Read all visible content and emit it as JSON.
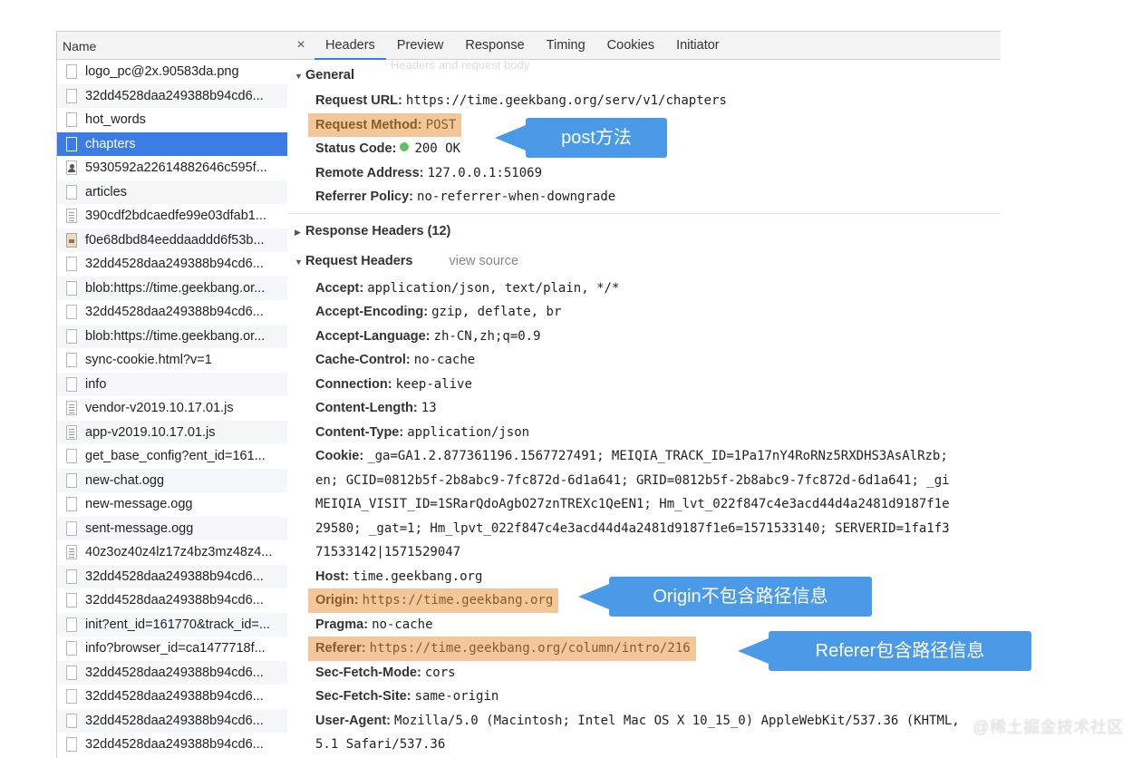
{
  "left": {
    "header": "Name",
    "items": [
      {
        "name": "logo_pc@2x.90583da.png",
        "icon": "file"
      },
      {
        "name": "32dd4528daa249388b94cd6...",
        "icon": "file"
      },
      {
        "name": "hot_words",
        "icon": "file"
      },
      {
        "name": "chapters",
        "icon": "file",
        "selected": true
      },
      {
        "name": "5930592a22614882646c595f...",
        "icon": "person"
      },
      {
        "name": "articles",
        "icon": "file"
      },
      {
        "name": "390cdf2bdcaedfe99e03dfab1...",
        "icon": "doc"
      },
      {
        "name": "f0e68dbd84eeddaaddd6f53b...",
        "icon": "img"
      },
      {
        "name": "32dd4528daa249388b94cd6...",
        "icon": "file"
      },
      {
        "name": "blob:https://time.geekbang.or...",
        "icon": "file"
      },
      {
        "name": "32dd4528daa249388b94cd6...",
        "icon": "file"
      },
      {
        "name": "blob:https://time.geekbang.or...",
        "icon": "file"
      },
      {
        "name": "sync-cookie.html?v=1",
        "icon": "file"
      },
      {
        "name": "info",
        "icon": "file"
      },
      {
        "name": "vendor-v2019.10.17.01.js",
        "icon": "doc"
      },
      {
        "name": "app-v2019.10.17.01.js",
        "icon": "doc"
      },
      {
        "name": "get_base_config?ent_id=161...",
        "icon": "file"
      },
      {
        "name": "new-chat.ogg",
        "icon": "file"
      },
      {
        "name": "new-message.ogg",
        "icon": "file"
      },
      {
        "name": "sent-message.ogg",
        "icon": "file"
      },
      {
        "name": "40z3oz40z4lz17z4bz3mz48z4...",
        "icon": "doc"
      },
      {
        "name": "32dd4528daa249388b94cd6...",
        "icon": "file"
      },
      {
        "name": "32dd4528daa249388b94cd6...",
        "icon": "file"
      },
      {
        "name": "init?ent_id=161770&track_id=...",
        "icon": "file"
      },
      {
        "name": "info?browser_id=ca1477718f...",
        "icon": "file"
      },
      {
        "name": "32dd4528daa249388b94cd6...",
        "icon": "file"
      },
      {
        "name": "32dd4528daa249388b94cd6...",
        "icon": "file"
      },
      {
        "name": "32dd4528daa249388b94cd6...",
        "icon": "file"
      },
      {
        "name": "32dd4528daa249388b94cd6...",
        "icon": "file"
      }
    ]
  },
  "tabs": {
    "close": "×",
    "items": [
      "Headers",
      "Preview",
      "Response",
      "Timing",
      "Cookies",
      "Initiator"
    ],
    "active": "Headers",
    "tooltip": "Headers and request body"
  },
  "general": {
    "title": "General",
    "request_url": {
      "k": "Request URL:",
      "v": "https://time.geekbang.org/serv/v1/chapters"
    },
    "request_method": {
      "k": "Request Method:",
      "v": "POST"
    },
    "status_code": {
      "k": "Status Code:",
      "v": "200 OK"
    },
    "remote_address": {
      "k": "Remote Address:",
      "v": "127.0.0.1:51069"
    },
    "referrer_policy": {
      "k": "Referrer Policy:",
      "v": "no-referrer-when-downgrade"
    }
  },
  "response_headers": {
    "title": "Response Headers (12)"
  },
  "request_headers": {
    "title": "Request Headers",
    "view_source": "view source",
    "accept": {
      "k": "Accept:",
      "v": "application/json, text/plain, */*"
    },
    "accept_encoding": {
      "k": "Accept-Encoding:",
      "v": "gzip, deflate, br"
    },
    "accept_language": {
      "k": "Accept-Language:",
      "v": "zh-CN,zh;q=0.9"
    },
    "cache_control": {
      "k": "Cache-Control:",
      "v": "no-cache"
    },
    "connection": {
      "k": "Connection:",
      "v": "keep-alive"
    },
    "content_length": {
      "k": "Content-Length:",
      "v": "13"
    },
    "content_type": {
      "k": "Content-Type:",
      "v": "application/json"
    },
    "cookie": {
      "k": "Cookie:",
      "line1": "_ga=GA1.2.877361196.1567727491; MEIQIA_TRACK_ID=1Pa17nY4RoRNz5RXDHS3AsAlRzb;",
      "line2": "en; GCID=0812b5f-2b8abc9-7fc872d-6d1a641; GRID=0812b5f-2b8abc9-7fc872d-6d1a641; _gi",
      "line3": "MEIQIA_VISIT_ID=1SRarQdoAgbO27znTREXc1QeEN1; Hm_lvt_022f847c4e3acd44d4a2481d9187f1e",
      "line4": "29580; _gat=1; Hm_lpvt_022f847c4e3acd44d4a2481d9187f1e6=1571533140; SERVERID=1fa1f3",
      "line5": "71533142|1571529047"
    },
    "host": {
      "k": "Host:",
      "v": "time.geekbang.org"
    },
    "origin": {
      "k": "Origin:",
      "v": "https://time.geekbang.org"
    },
    "pragma": {
      "k": "Pragma:",
      "v": "no-cache"
    },
    "referer": {
      "k": "Referer:",
      "v": "https://time.geekbang.org/column/intro/216"
    },
    "sec_fetch_mode": {
      "k": "Sec-Fetch-Mode:",
      "v": "cors"
    },
    "sec_fetch_site": {
      "k": "Sec-Fetch-Site:",
      "v": "same-origin"
    },
    "user_agent": {
      "k": "User-Agent:",
      "v": "Mozilla/5.0 (Macintosh; Intel Mac OS X 10_15_0) AppleWebKit/537.36 (KHTML,",
      "v2": "5.1 Safari/537.36"
    }
  },
  "callouts": {
    "post": "post方法",
    "origin": "Origin不包含路径信息",
    "referer": "Referer包含路径信息"
  },
  "watermark": "@稀土掘金技术社区",
  "colors": {
    "selected": "#3b7de5",
    "highlight": "#f4c79b",
    "callout": "#4a9ae8",
    "status_ok": "#5fc25a"
  }
}
